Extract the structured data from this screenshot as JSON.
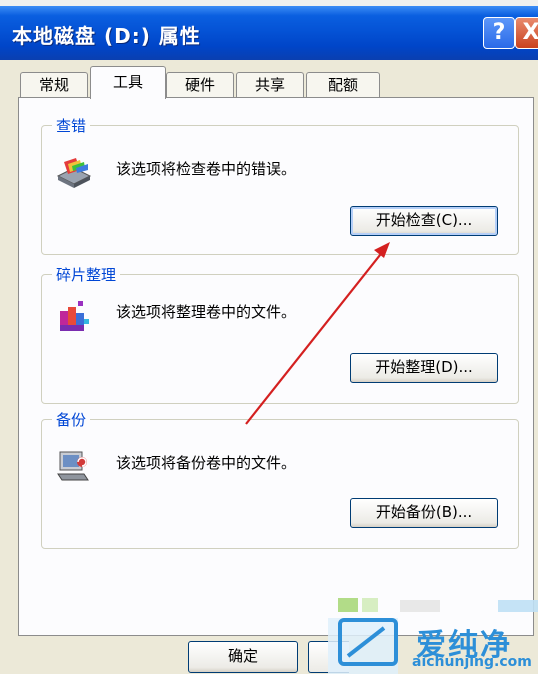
{
  "window": {
    "title": "本地磁盘 (D:) 属性",
    "help_label": "?",
    "close_label": "X"
  },
  "tabs": [
    {
      "label": "常规"
    },
    {
      "label": "工具"
    },
    {
      "label": "硬件"
    },
    {
      "label": "共享"
    },
    {
      "label": "配额"
    }
  ],
  "active_tab": "工具",
  "groups": {
    "error_check": {
      "label": "查错",
      "description": "该选项将检查卷中的错误。",
      "button": "开始检查(C)...",
      "icon": "disk-check-icon"
    },
    "defrag": {
      "label": "碎片整理",
      "description": "该选项将整理卷中的文件。",
      "button": "开始整理(D)...",
      "icon": "defrag-icon"
    },
    "backup": {
      "label": "备份",
      "description": "该选项将备份卷中的文件。",
      "button": "开始备份(B)...",
      "icon": "backup-icon"
    }
  },
  "footer": {
    "ok": "确定"
  },
  "watermark": {
    "text": "爱纯净",
    "url": "aichunjing.com"
  },
  "colors": {
    "titlebar": "#0553d6",
    "group_label": "#0046d5",
    "annotation_arrow": "#d42020",
    "watermark": "#2d8fd8"
  }
}
